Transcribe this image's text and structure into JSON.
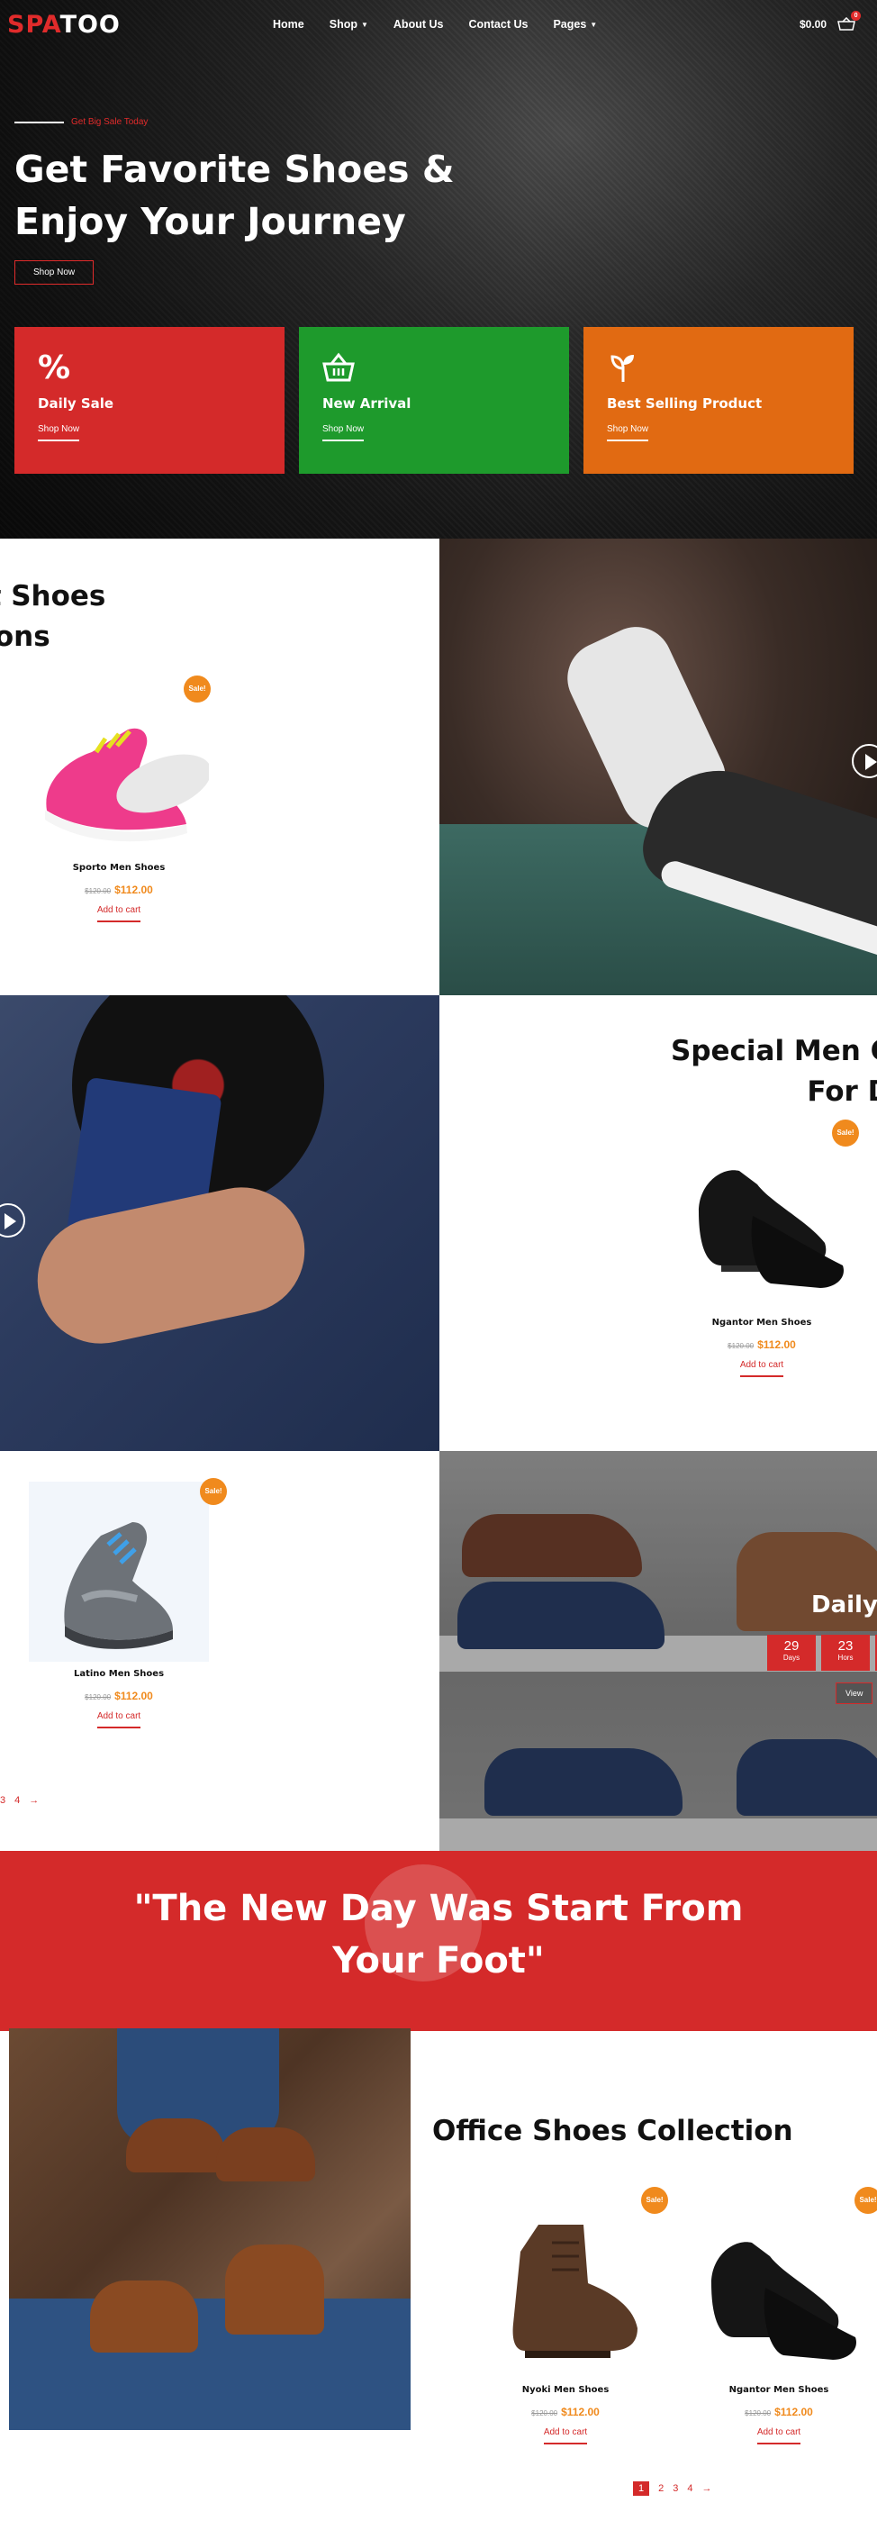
{
  "brand": {
    "part1": "SPA",
    "part2": "TOO"
  },
  "nav": {
    "items": [
      {
        "label": "Home",
        "caret": false
      },
      {
        "label": "Shop",
        "caret": true
      },
      {
        "label": "About Us",
        "caret": false
      },
      {
        "label": "Contact Us",
        "caret": false
      },
      {
        "label": "Pages",
        "caret": true
      }
    ],
    "cart_total": "$0.00",
    "cart_count": "0"
  },
  "hero": {
    "eyebrow": "Get Big Sale Today",
    "title_line1": "Get Favorite Shoes &",
    "title_line2": "Enjoy Your Journey",
    "button": "Shop Now"
  },
  "promos": [
    {
      "icon": "%",
      "title": "Daily Sale",
      "link": "Shop Now",
      "color": "#d42a2a"
    },
    {
      "icon": "basket",
      "title": "New Arrival",
      "link": "Shop Now",
      "color": "#1e9a2c"
    },
    {
      "icon": "sprout",
      "title": "Best Selling Product",
      "link": "Shop Now",
      "color": "#e16a12"
    }
  ],
  "sections": {
    "sport": {
      "title_line1": "ort Shoes",
      "title_line2": "ctions"
    },
    "special": {
      "title_line1": "Special Men C",
      "title_line2": "For D"
    },
    "daily": {
      "title": "Daily",
      "days_value": "29",
      "days_label": "Days",
      "hours_value": "23",
      "hours_label": "Hors",
      "view_label": "View"
    },
    "office": {
      "title": "Office Shoes Collection"
    }
  },
  "products": {
    "sporto": {
      "name": "Sporto Men Shoes",
      "old_price": "$120.00",
      "price": "$112.00",
      "cta": "Add to cart",
      "badge": "Sale!"
    },
    "ngantor1": {
      "name": "Ngantor Men Shoes",
      "old_price": "$120.00",
      "price": "$112.00",
      "cta": "Add to cart",
      "badge": "Sale!"
    },
    "latino": {
      "name": "Latino Men Shoes",
      "old_price": "$120.00",
      "price": "$112.00",
      "cta": "Add to cart",
      "badge": "Sale!"
    },
    "nyoki": {
      "name": "Nyoki Men Shoes",
      "old_price": "$120.00",
      "price": "$112.00",
      "cta": "Add to cart",
      "badge": "Sale!"
    },
    "ngantor2": {
      "name": "Ngantor Men Shoes",
      "old_price": "$120.00",
      "price": "$112.00",
      "cta": "Add to cart",
      "badge": "Sale!"
    }
  },
  "pager_left": {
    "p3": "3",
    "p4": "4",
    "next": "→"
  },
  "pager_right": {
    "p1": "1",
    "p2": "2",
    "p3": "3",
    "p4": "4",
    "next": "→"
  },
  "quote": {
    "line1": "\"The New Day Was Start From",
    "line2": "Your Foot\""
  }
}
